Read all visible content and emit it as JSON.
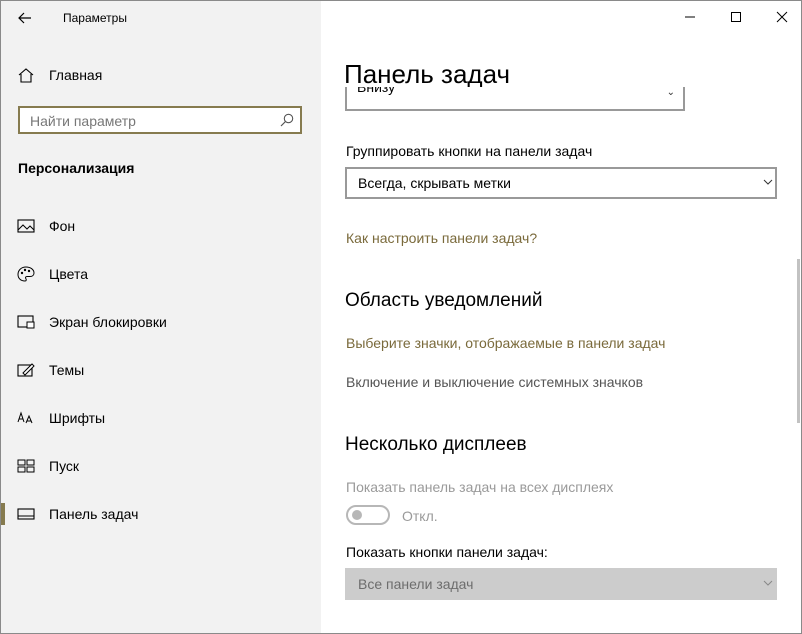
{
  "window": {
    "app_title": "Параметры"
  },
  "sidebar": {
    "home_label": "Главная",
    "search_placeholder": "Найти параметр",
    "section_title": "Персонализация",
    "items": [
      {
        "label": "Фон",
        "icon": "picture-icon"
      },
      {
        "label": "Цвета",
        "icon": "palette-icon"
      },
      {
        "label": "Экран блокировки",
        "icon": "lock-screen-icon"
      },
      {
        "label": "Темы",
        "icon": "themes-icon"
      },
      {
        "label": "Шрифты",
        "icon": "fonts-icon"
      },
      {
        "label": "Пуск",
        "icon": "start-icon"
      },
      {
        "label": "Панель задач",
        "icon": "taskbar-icon",
        "active": true
      }
    ]
  },
  "main": {
    "page_title": "Панель задач",
    "position_dropdown_value": "Внизу",
    "group_label": "Группировать кнопки на панели задач",
    "group_value": "Всегда, скрывать метки",
    "howto_link": "Как настроить панели задач?",
    "notif_heading": "Область уведомлений",
    "notif_link": "Выберите значки, отображаемые в панели задач",
    "notif_system": "Включение и выключение системных значков",
    "multi_heading": "Несколько дисплеев",
    "multi_show_label": "Показать панель задач на всех дисплеях",
    "multi_toggle_state": "Откл.",
    "multi_buttons_label": "Показать кнопки панели задач:",
    "multi_buttons_value": "Все панели задач"
  },
  "colors": {
    "accent": "#867b4f",
    "link": "#7a6a3b",
    "sidebar_bg": "#f2f2f2"
  }
}
